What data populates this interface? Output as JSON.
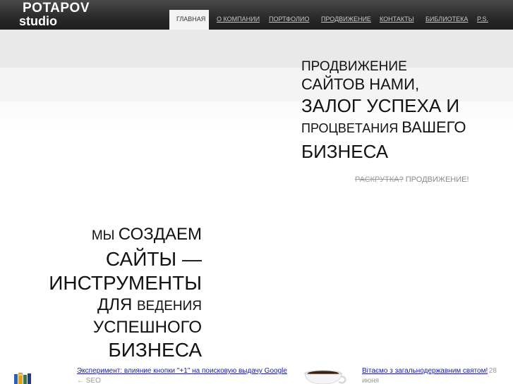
{
  "logo": {
    "line1": "POTAPOV",
    "line2": "studio"
  },
  "nav": {
    "items": [
      {
        "label": "ГЛАВНАЯ",
        "active": true
      },
      {
        "label": "О КОМПАНИИ"
      },
      {
        "label": "ПОРТФОЛИО"
      },
      {
        "label": "ПРОДВИЖЕНИЕ"
      },
      {
        "label": "КОНТАКТЫ"
      },
      {
        "label": "БИБЛИОТЕКА"
      },
      {
        "label": "P.S."
      }
    ]
  },
  "hero_right": {
    "line1": "ПРОДВИЖЕНИЕ",
    "line2": "САЙТОВ НАМИ,",
    "line3": "ЗАЛОГ УСПЕХА И",
    "line4_small": "ПРОЦВЕТАНИЯ ",
    "line4_big": "ВАШЕГО",
    "line5": "БИЗНЕСА"
  },
  "tagline": {
    "strike": "РАСКРУТКА?",
    "rest": " ПРОДВИЖЕНИЕ!"
  },
  "hero_left": {
    "line1_small": "МЫ ",
    "line1_big": "СОЗДАЕМ",
    "line2": "САЙТЫ —",
    "line3": "ИНСТРУМЕНТЫ",
    "line4_big": "ДЛЯ ",
    "line4_small": "ВЕДЕНИЯ",
    "line5": "УСПЕШНОГО",
    "line6": "БИЗНЕСА"
  },
  "news": [
    {
      "title": "Эксперимент: влияние кнопки \"+1\" на поисковую выдачу Google",
      "meta": "← SEO",
      "icon": "books-icon"
    },
    {
      "title": "Вітаємо з загальнодержавним святом!",
      "meta_line1": " — 28",
      "meta_line2": "июня",
      "icon": "coffee-cup-icon"
    }
  ]
}
